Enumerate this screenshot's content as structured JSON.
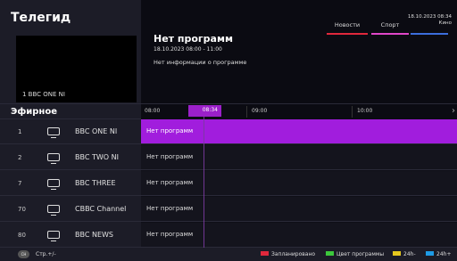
{
  "app_title": "Телегид",
  "preview": {
    "channel_label": "1 BBC ONE NI"
  },
  "info": {
    "title": "Нет программ",
    "time": "18.10.2023 08:00 - 11:00",
    "description": "Нет информации о программе"
  },
  "categories": [
    {
      "label": "Новости",
      "color": "#e0283c"
    },
    {
      "label": "Спорт",
      "color": "#e046c8"
    },
    {
      "label": "Кино",
      "color": "#3c6edc"
    }
  ],
  "clock": {
    "date": "18.10.2023 08:34",
    "category": "Кино"
  },
  "section_label": "Эфирное",
  "timeline": {
    "ticks": [
      "08:00",
      "09:00",
      "10:00"
    ],
    "now": "08:34"
  },
  "channels": [
    {
      "number": "1",
      "name": "BBC ONE NI",
      "program": "Нет программ"
    },
    {
      "number": "2",
      "name": "BBC TWO NI",
      "program": "Нет программ"
    },
    {
      "number": "7",
      "name": "BBC THREE",
      "program": "Нет программ"
    },
    {
      "number": "70",
      "name": "CBBC Channel",
      "program": "Нет программ"
    },
    {
      "number": "80",
      "name": "BBC NEWS",
      "program": "Нет программ"
    }
  ],
  "footer": {
    "page_button": "CH",
    "page_hint": "Стр.+/-",
    "legend": [
      {
        "label": "Запланировано",
        "color": "#e0283c"
      },
      {
        "label": "Цвет программы",
        "color": "#3cc83c"
      },
      {
        "label": "24h-",
        "color": "#e6c81e"
      },
      {
        "label": "24h+",
        "color": "#1e9be6"
      }
    ]
  },
  "colors": {
    "accent": "#a11ddd",
    "background": "#0f0f17"
  }
}
